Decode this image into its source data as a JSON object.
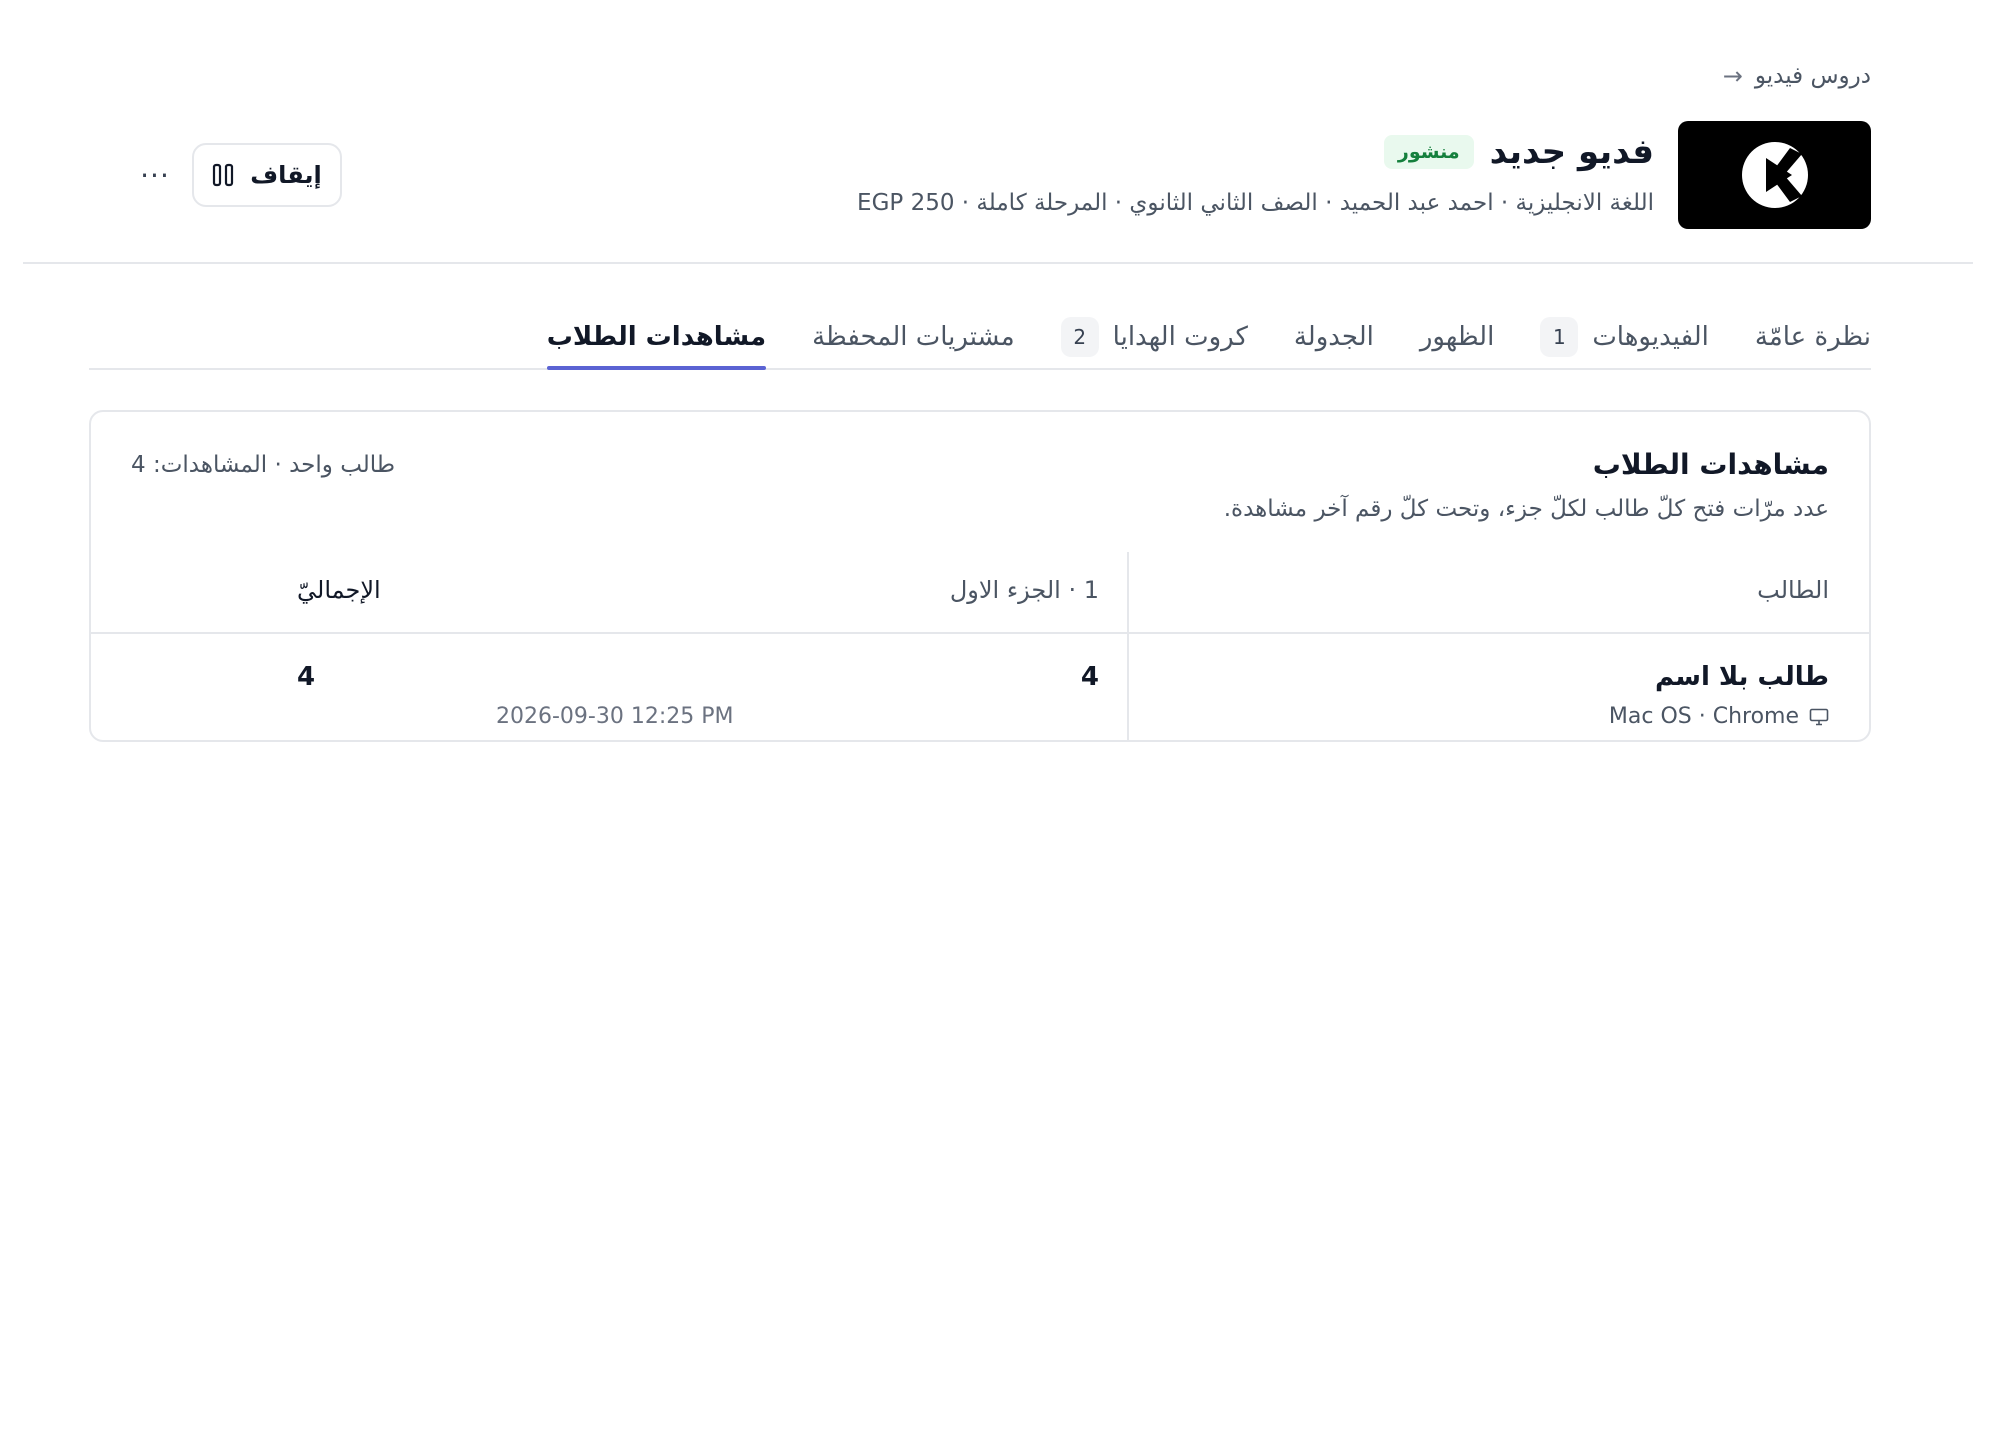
{
  "breadcrumb": {
    "label": "دروس فيديو",
    "arrow": "→"
  },
  "header": {
    "title": "فديو جديد",
    "status": "منشور",
    "meta": "اللغة الانجليزية · احمد عبد الحميد · الصف الثاني الثانوي · المرحلة كاملة · EGP 250",
    "stop_label": "إيقاف",
    "more_label": "···"
  },
  "tabs": [
    {
      "label": "نظرة عامّة",
      "count": null,
      "active": false
    },
    {
      "label": "الفيديوهات",
      "count": "1",
      "active": false
    },
    {
      "label": "الظهور",
      "count": null,
      "active": false
    },
    {
      "label": "الجدولة",
      "count": null,
      "active": false
    },
    {
      "label": "كروت الهدايا",
      "count": "2",
      "active": false
    },
    {
      "label": "مشتريات المحفظة",
      "count": null,
      "active": false
    },
    {
      "label": "مشاهدات الطلاب",
      "count": null,
      "active": true
    }
  ],
  "card": {
    "title": "مشاهدات الطلاب",
    "description": "عدد مرّات فتح كلّ طالب لكلّ جزء، وتحت كلّ رقم آخر مشاهدة.",
    "summary": "طالب واحد · المشاهدات: 4",
    "columns": {
      "student": "الطالب",
      "part": "1 · الجزء الاول",
      "total": "الإجماليّ"
    },
    "rows": [
      {
        "student": "طالب بلا اسم",
        "device": "Mac OS · Chrome",
        "part_views": "4",
        "last_view": "2026-09-30 12:25 PM",
        "total": "4"
      }
    ]
  },
  "colors": {
    "accent": "#5b63d3",
    "published_bg": "#e9f9ee",
    "published_text": "#15803d"
  },
  "icons": {
    "breadcrumb": "arrow-right-icon",
    "thumbnail": "play-logo-icon",
    "stop": "pause-icon",
    "device": "monitor-icon"
  }
}
